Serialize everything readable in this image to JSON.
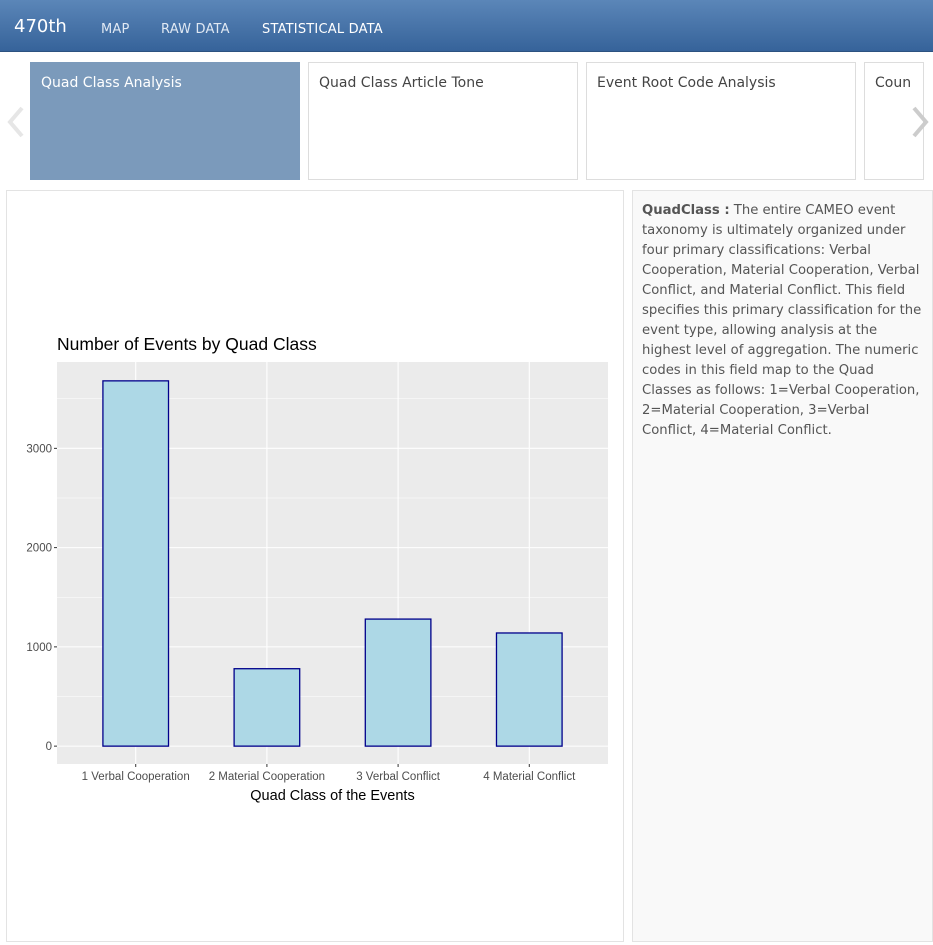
{
  "navbar": {
    "brand": "470th",
    "links": [
      "MAP",
      "RAW DATA",
      "STATISTICAL DATA"
    ],
    "active": "STATISTICAL DATA"
  },
  "carousel": {
    "cards": [
      "Quad Class Analysis",
      "Quad Class Article Tone",
      "Event Root Code Analysis",
      "Coun"
    ],
    "active_index": 0
  },
  "info": {
    "term": "QuadClass :",
    "text": " The entire CAMEO event taxonomy is ultimately organized under four primary classifications: Verbal Cooperation, Material Cooperation, Verbal Conflict, and Material Conflict. This field specifies this primary classification for the event type, allowing analysis at the highest level of aggregation. The numeric codes in this field map to the Quad Classes as follows: 1=Verbal Cooperation, 2=Material Cooperation, 3=Verbal Conflict, 4=Material Conflict."
  },
  "chart_data": {
    "type": "bar",
    "title": "Number of Events by Quad Class",
    "xlabel": "Quad Class of the Events",
    "ylabel": "",
    "categories": [
      "1 Verbal Cooperation",
      "2 Material Cooperation",
      "3 Verbal Conflict",
      "4 Material Conflict"
    ],
    "values": [
      3680,
      780,
      1280,
      1140
    ],
    "ylim": [
      -180,
      3870
    ],
    "yticks": [
      0,
      1000,
      2000,
      3000
    ],
    "grid": true,
    "colors": {
      "bar_fill": "#add8e6",
      "bar_stroke": "#00008b",
      "panel_bg": "#ebebeb",
      "grid": "#ffffff"
    }
  }
}
